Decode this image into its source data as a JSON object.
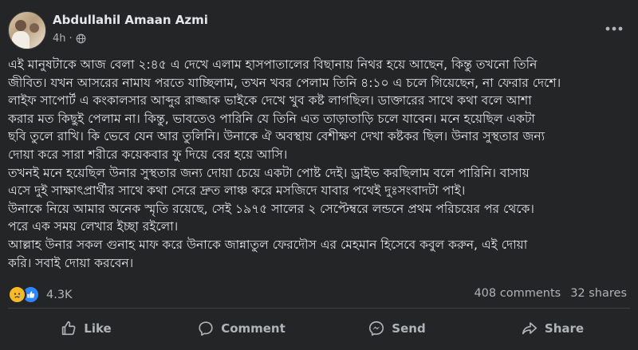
{
  "post": {
    "author": "Abdullahil Amaan Azmi",
    "time": "4h",
    "privacy_icon": "globe-icon",
    "more_icon": "more-dots-icon",
    "body_lines": [
      "এই মানুষটাকে আজ বেলা ২:৪৫ এ দেখে এলাম হাসপাতালের বিছানায় নিথর হয়ে আছেন, কিন্তু তখনো তিনি",
      "জীবিত। যখন আসরের নামায পরতে যাচ্ছিলাম, তখন খবর পেলাম তিনি ৪:১০ এ চলে গিয়েছেন, না ফেরার দেশে।",
      "লাইফ সাপোর্ট এ কংকালসার আব্দুর রাজ্জাক ভাইকে দেখে খুব কষ্ট লাগছিল। ডাক্তারের সাথে কথা বলে আশা",
      "করার মত কিছুই পেলাম না। কিন্তু, ভাবতেও পারিনি যে তিনি এত তাড়াতাড়ি চলে যাবেন। মনে হয়েছিল একটা",
      "ছবি তুলে রাখি। কি ভেবে যেন আর তুলিনি। উনাকে ঐ অবস্থায় বেশীক্ষণ দেখা কষ্টকর ছিল। উনার সুস্থতার জন্য",
      "দোয়া করে সারা শরীরে কয়েকবার ফু দিয়ে বের হয়ে আসি।",
      "তখনই মনে হয়েছিল উনার সুস্থতার জন্য দোয়া চেয়ে একটা পোষ্ট দেই। ড্রাইভ করছিলাম বলে পারিনি। বাসায়",
      "এসে দুই সাক্ষাৎপ্রার্থীর সাথে কথা সেরে দ্রুত লাঞ্চ করে মসজিদে যাবার পথেই দুঃসংবাদটা পাই।",
      "উনাকে নিয়ে আমার অনেক স্মৃতি রয়েছে, সেই ১৯৭৫ সালের ২ সেপ্টেম্বরে লন্ডনে প্রথম  পরিচয়ের পর থেকে।",
      "পরে এক সময় লেখার ইচ্ছা রইলো।",
      "আল্লাহ উনার সকল গুনাহ মাফ করে উনাকে জান্নাতুল ফেরদৌস এর মেহমান হিসেবে কবুল করুন, এই দোয়া",
      "করি। সবাই দোয়া করবেন।"
    ]
  },
  "stats": {
    "reaction_icons": [
      "sad-reaction-icon",
      "like-reaction-icon"
    ],
    "reaction_count": "4.3K",
    "comments": "408 comments",
    "shares": "32 shares"
  },
  "actions": [
    {
      "label": "Like",
      "icon": "like-icon"
    },
    {
      "label": "Comment",
      "icon": "comment-icon"
    },
    {
      "label": "Send",
      "icon": "send-icon"
    },
    {
      "label": "Share",
      "icon": "share-icon"
    }
  ],
  "colors": {
    "background": "#242526",
    "text": "#e4e6eb",
    "secondary_text": "#b0b3b8",
    "like_blue": "#2d88ff",
    "sad_yellow": "#f7b928"
  }
}
